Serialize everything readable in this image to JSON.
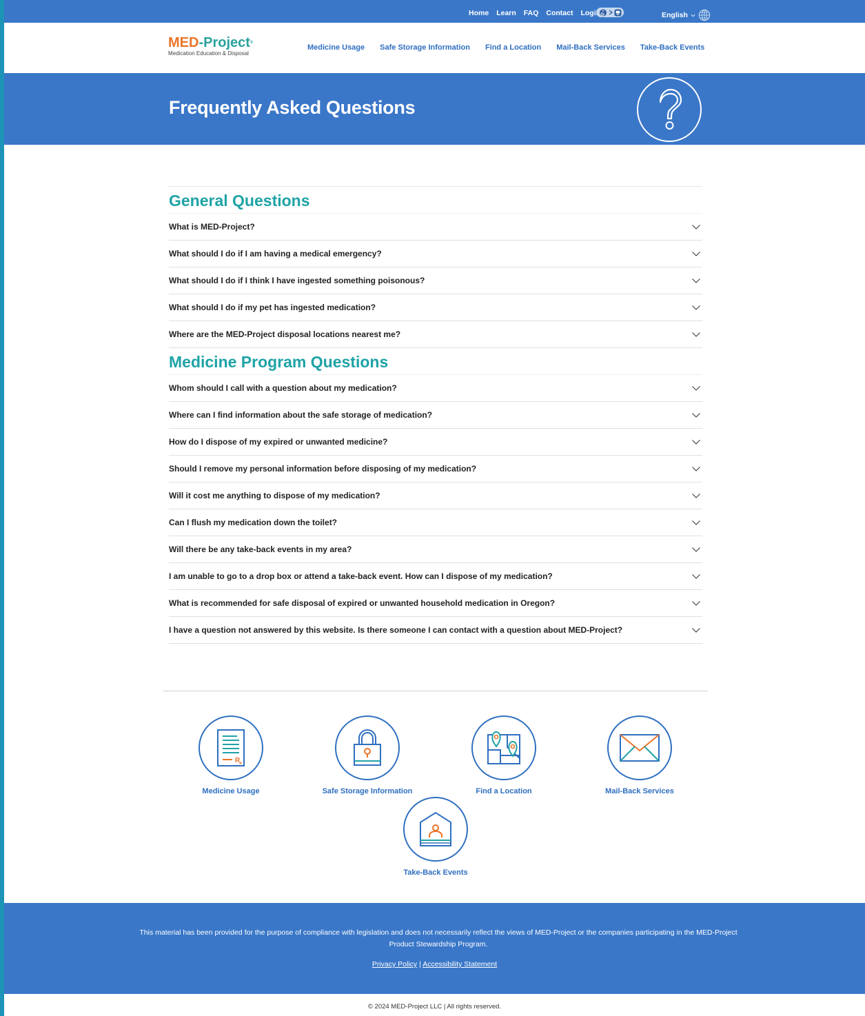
{
  "topbar": {
    "links": [
      "Home",
      "Learn",
      "FAQ",
      "Contact",
      "Login"
    ],
    "language": "English"
  },
  "logo": {
    "brand_a": "MED",
    "brand_b": "-Project",
    "tagline": "Medication Education & Disposal"
  },
  "nav": [
    "Medicine Usage",
    "Safe Storage Information",
    "Find a Location",
    "Mail-Back Services",
    "Take-Back Events"
  ],
  "hero": {
    "title": "Frequently Asked Questions",
    "icon": "question-mark-icon"
  },
  "sections": [
    {
      "title": "General Questions",
      "questions": [
        "What is MED-Project?",
        "What should I do if I am having a medical emergency?",
        "What should I do if I think I have ingested something poisonous?",
        "What should I do if my pet has ingested medication?",
        "Where are the MED-Project disposal locations nearest me?"
      ]
    },
    {
      "title": "Medicine Program Questions",
      "questions": [
        "Whom should I call with a question about my medication?",
        "Where can I find information about the safe storage of medication?",
        "How do I dispose of my expired or unwanted medicine?",
        "Should I remove my personal information before disposing of my medication?",
        "Will it cost me anything to dispose of my medication?",
        "Can I flush my medication down the toilet?",
        "Will there be any take-back events in my area?",
        "I am unable to go to a drop box or attend a take-back event. How can I dispose of my medication?",
        "What is recommended for safe disposal of expired or unwanted household medication in Oregon?",
        "I have a question not answered by this website. Is there someone I can contact with a question about MED-Project?"
      ]
    }
  ],
  "tiles": [
    {
      "label": "Medicine Usage",
      "icon": "prescription-icon"
    },
    {
      "label": "Safe Storage Information",
      "icon": "padlock-icon"
    },
    {
      "label": "Find a Location",
      "icon": "map-pin-icon"
    },
    {
      "label": "Mail-Back Services",
      "icon": "envelope-icon"
    },
    {
      "label": "Take-Back Events",
      "icon": "booth-icon"
    }
  ],
  "footer": {
    "disclaimer": "This material has been provided for the purpose of compliance with legislation and does not necessarily reflect the views of MED-Project or the companies participating in the MED-Project Product Stewardship Program.",
    "privacy": "Privacy Policy",
    "separator": "|",
    "accessibility": "Accessibility Statement",
    "copyright": "© 2024 MED-Project LLC | All rights reserved."
  },
  "colors": {
    "brand_blue": "#3a77c8",
    "teal": "#1fa3a6",
    "orange": "#ea7428"
  }
}
